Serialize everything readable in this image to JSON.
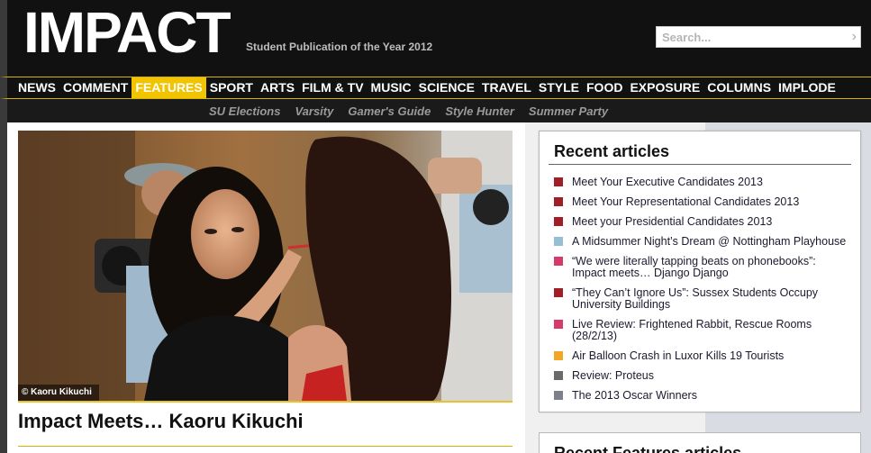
{
  "site": {
    "logo": "IMPACT",
    "tagline": "Student Publication of the Year 2012",
    "search_placeholder": "Search..."
  },
  "main_nav": [
    {
      "label": "NEWS",
      "active": false
    },
    {
      "label": "COMMENT",
      "active": false
    },
    {
      "label": "FEATURES",
      "active": true
    },
    {
      "label": "SPORT",
      "active": false
    },
    {
      "label": "ARTS",
      "active": false
    },
    {
      "label": "FILM & TV",
      "active": false
    },
    {
      "label": "MUSIC",
      "active": false
    },
    {
      "label": "SCIENCE",
      "active": false
    },
    {
      "label": "TRAVEL",
      "active": false
    },
    {
      "label": "STYLE",
      "active": false
    },
    {
      "label": "FOOD",
      "active": false
    },
    {
      "label": "EXPOSURE",
      "active": false
    },
    {
      "label": "COLUMNS",
      "active": false
    },
    {
      "label": "IMPLODE",
      "active": false
    }
  ],
  "sub_nav": [
    "SU Elections",
    "Varsity",
    "Gamer's Guide",
    "Style Hunter",
    "Summer Party"
  ],
  "feature": {
    "photo_credit": "© Kaoru Kikuchi",
    "headline": "Impact Meets… Kaoru Kikuchi"
  },
  "recent": {
    "title": "Recent articles",
    "items": [
      {
        "text": "Meet Your Executive Candidates 2013",
        "color": "#a01e25"
      },
      {
        "text": "Meet Your Representational Candidates 2013",
        "color": "#a01e25"
      },
      {
        "text": "Meet your Presidential Candidates 2013",
        "color": "#a01e25"
      },
      {
        "text": "A Midsummer Night’s Dream @ Nottingham Playhouse",
        "color": "#96bfd6"
      },
      {
        "text": "“We were literally tapping beats on phonebooks”: Impact meets… Django Django",
        "color": "#d63a6a"
      },
      {
        "text": "“They Can’t Ignore Us”: Sussex Students Occupy University Buildings",
        "color": "#a01e25"
      },
      {
        "text": "Live Review: Frightened Rabbit, Rescue Rooms (28/2/13)",
        "color": "#d63a6a"
      },
      {
        "text": "Air Balloon Crash in Luxor Kills 19 Tourists",
        "color": "#f2a623"
      },
      {
        "text": "Review: Proteus",
        "color": "#6a6a6a"
      },
      {
        "text": "The 2013 Oscar Winners",
        "color": "#7d8088"
      }
    ]
  },
  "recent_features": {
    "title": "Recent Features articles"
  }
}
